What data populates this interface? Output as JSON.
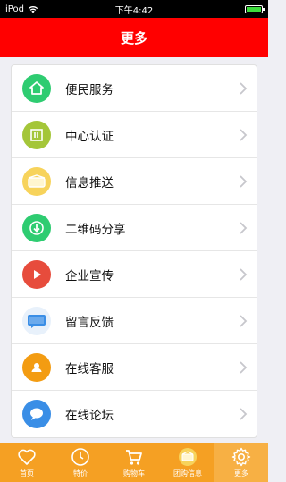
{
  "status_bar": {
    "carrier": "iPod",
    "time": "下午4:42"
  },
  "nav": {
    "title": "更多"
  },
  "menu": {
    "items": [
      {
        "label": "便民服务",
        "icon": "house-icon",
        "color": "#2ecc71"
      },
      {
        "label": "中心认证",
        "icon": "certificate-icon",
        "color": "#a4c639"
      },
      {
        "label": "信息推送",
        "icon": "envelope-icon",
        "color": "#f7d35b"
      },
      {
        "label": "二维码分享",
        "icon": "download-icon",
        "color": "#2ecc71"
      },
      {
        "label": "企业宣传",
        "icon": "play-icon",
        "color": "#e74c3c"
      },
      {
        "label": "留言反馈",
        "icon": "message-icon",
        "color": "#3a8ee6"
      },
      {
        "label": "在线客服",
        "icon": "user-icon",
        "color": "#f39c12"
      },
      {
        "label": "在线论坛",
        "icon": "chat-bubble-icon",
        "color": "#3a8ee6"
      }
    ]
  },
  "tabs": [
    {
      "label": "首页",
      "icon": "heart-icon"
    },
    {
      "label": "特价",
      "icon": "clock-icon"
    },
    {
      "label": "购物车",
      "icon": "cart-icon"
    },
    {
      "label": "团购信息",
      "icon": "envelope-icon"
    },
    {
      "label": "更多",
      "icon": "gear-icon",
      "active": true
    }
  ],
  "colors": {
    "nav_red": "#ff0000",
    "tab_orange": "#f5a023",
    "chevron": "#c7c7cc"
  }
}
